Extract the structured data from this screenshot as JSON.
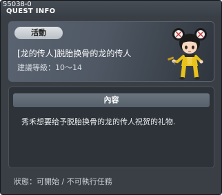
{
  "window": {
    "quest_id": "55038-0",
    "title": "QUEST INFO"
  },
  "quest": {
    "category": "活動",
    "name": "[龙的传人]脱胎换骨的龙的传人",
    "level_requirement": "建議等級：10～14",
    "portrait_icon": "npc-portrait-icon"
  },
  "description": {
    "header": "內容",
    "text": "秀禾想要给予脱胎换骨的龙的传人祝贺的礼物."
  },
  "status": {
    "text": "狀態：可開始 / 不可執行任務"
  },
  "colors": {
    "window_bg": "#3a3f46",
    "panel_bg": "#2e3339",
    "header_bg": "#6a7580",
    "badge_bg": "#dfe3e6",
    "character_outfit": "#e8c21a"
  }
}
